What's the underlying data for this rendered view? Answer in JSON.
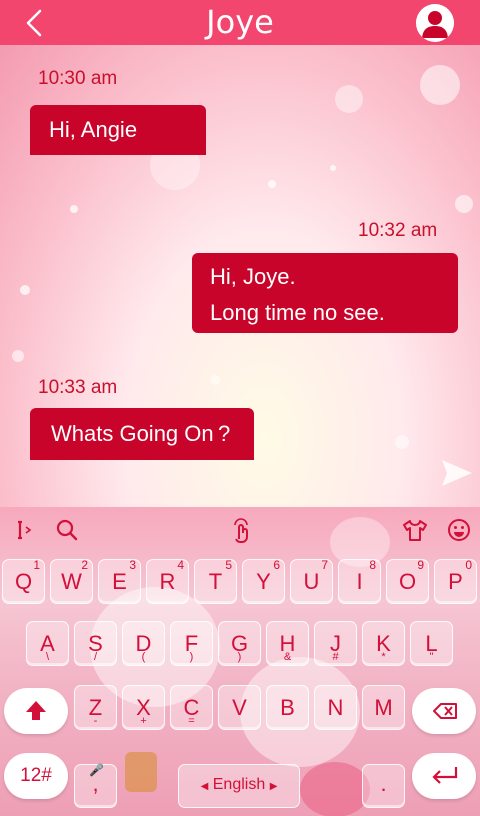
{
  "header": {
    "title": "Joye",
    "back_icon": "chevron-left-icon",
    "avatar_icon": "user-avatar-icon",
    "color": "#f2466e"
  },
  "messages": [
    {
      "time": "10:30 am",
      "direction": "incoming",
      "lines": [
        "Hi, Angie"
      ]
    },
    {
      "time": "10:32 am",
      "direction": "outgoing",
      "lines": [
        "Hi, Joye.",
        "Long time no see."
      ]
    },
    {
      "time": "10:33 am",
      "direction": "incoming",
      "lines": [
        "Whats Going On ?"
      ]
    }
  ],
  "bubble_color": "#c8042b",
  "composer": {
    "send_icon": "send-icon"
  },
  "keyboard": {
    "toolbar": [
      "text-cursor-icon",
      "search-icon",
      "touch-icon",
      "theme-shirt-icon",
      "emoji-icon"
    ],
    "row1": [
      {
        "k": "Q",
        "h": "1"
      },
      {
        "k": "W",
        "h": "2"
      },
      {
        "k": "E",
        "h": "3"
      },
      {
        "k": "R",
        "h": "4"
      },
      {
        "k": "T",
        "h": "5"
      },
      {
        "k": "Y",
        "h": "6"
      },
      {
        "k": "U",
        "h": "7"
      },
      {
        "k": "I",
        "h": "8"
      },
      {
        "k": "O",
        "h": "9"
      },
      {
        "k": "P",
        "h": "0"
      }
    ],
    "row2": [
      {
        "k": "A",
        "h": "\\"
      },
      {
        "k": "S",
        "h": "/"
      },
      {
        "k": "D",
        "h": "("
      },
      {
        "k": "F",
        "h": ")"
      },
      {
        "k": "G",
        "h": ")"
      },
      {
        "k": "H",
        "h": "&"
      },
      {
        "k": "J",
        "h": "#"
      },
      {
        "k": "K",
        "h": "*"
      },
      {
        "k": "L",
        "h": "\""
      }
    ],
    "row3": [
      {
        "k": "Z",
        "h": "-"
      },
      {
        "k": "X",
        "h": "+"
      },
      {
        "k": "C",
        "h": "="
      },
      {
        "k": "V",
        "h": ""
      },
      {
        "k": "B",
        "h": ""
      },
      {
        "k": "N",
        "h": ""
      },
      {
        "k": "M",
        "h": ""
      }
    ],
    "shift_icon": "shift-arrow-icon",
    "backspace_icon": "backspace-icon",
    "symbols_label": "12#",
    "comma_label": ",",
    "space_label": "English",
    "period_label": ".",
    "enter_icon": "enter-arrow-icon",
    "accent": "#d3103a"
  }
}
